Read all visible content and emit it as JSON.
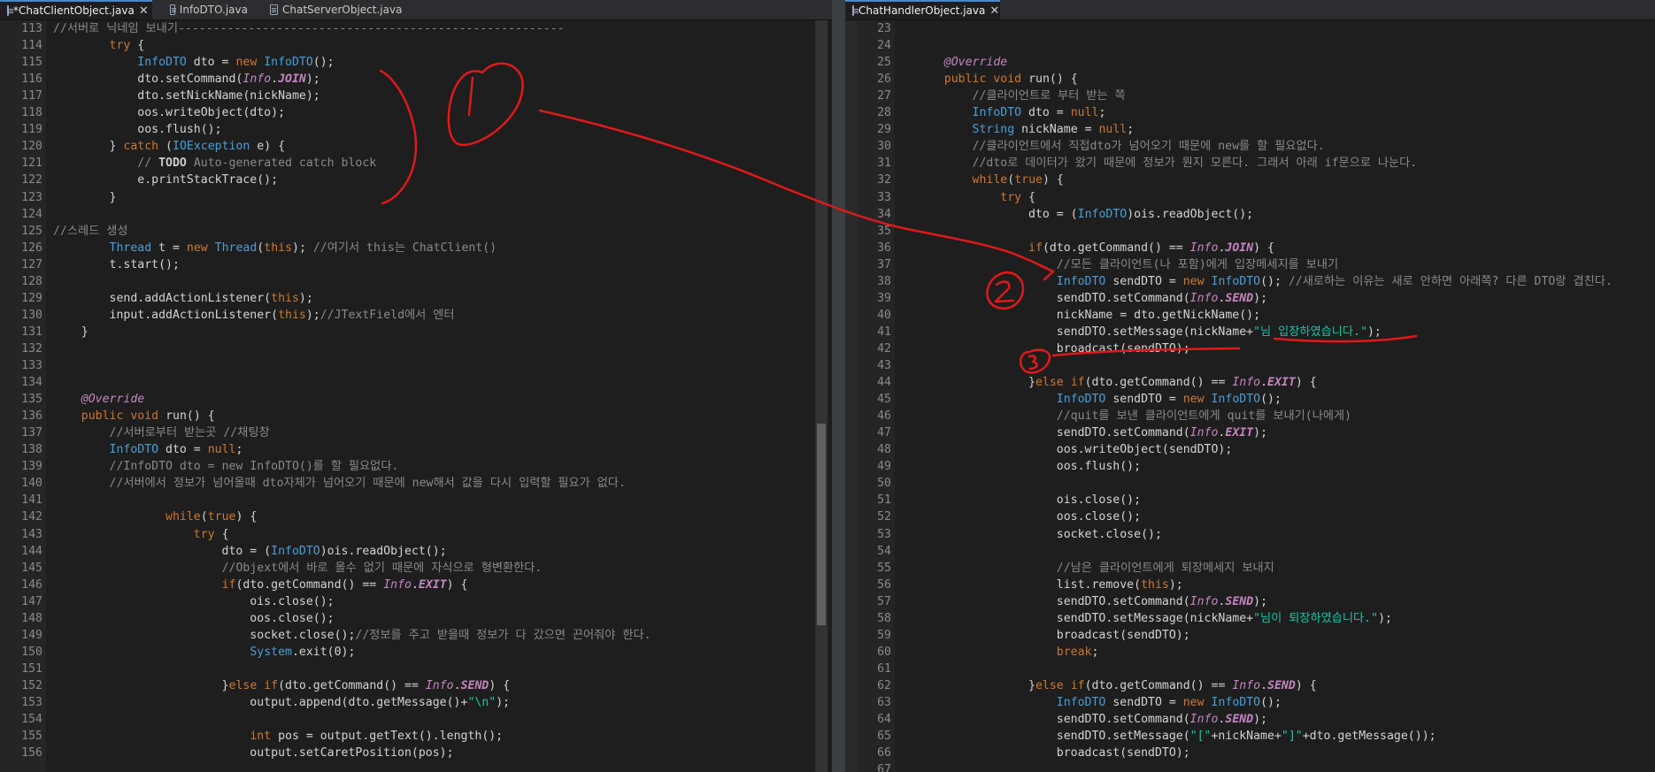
{
  "left_tabs": [
    "*ChatClientObject.java",
    "InfoDTO.java",
    "ChatServerObject.java"
  ],
  "right_tabs": [
    "ChatHandlerObject.java"
  ],
  "left_start": 113,
  "right_start": 23,
  "left_lines": [
    "//서버로 닉네임 보내기-------------------------------------------------------",
    "        try {",
    "            InfoDTO dto = new InfoDTO();",
    "            dto.setCommand(Info.JOIN);",
    "            dto.setNickName(nickName);",
    "            oos.writeObject(dto);",
    "            oos.flush();",
    "        } catch (IOException e) {",
    "            // TODO Auto-generated catch block",
    "            e.printStackTrace();",
    "        }",
    "",
    "//스레드 생성",
    "        Thread t = new Thread(this); //여기서 this는 ChatClient()",
    "        t.start();",
    "",
    "        send.addActionListener(this);",
    "        input.addActionListener(this);//JTextField에서 엔터",
    "    }",
    "",
    "",
    "",
    "    @Override",
    "    public void run() {",
    "        //서버로부터 받는곳 //채팅창",
    "        InfoDTO dto = null;",
    "        //InfoDTO dto = new InfoDTO()를 할 필요없다.",
    "        //서버에서 정보가 넘어올때 dto자체가 넘어오기 때문에 new해서 값을 다시 입력할 필요가 없다.",
    "",
    "                while(true) {",
    "                    try {",
    "                        dto = (InfoDTO)ois.readObject();",
    "                        //Objext에서 바로 올수 없기 때문에 자식으로 형변환한다.",
    "                        if(dto.getCommand() == Info.EXIT) {",
    "                            ois.close();",
    "                            oos.close();",
    "                            socket.close();//정보를 주고 받을때 정보가 다 갔으면 끈어줘야 한다.",
    "                            System.exit(0);",
    "",
    "                        }else if(dto.getCommand() == Info.SEND) {",
    "                            output.append(dto.getMessage()+\"\\n\");",
    "",
    "                            int pos = output.getText().length();",
    "                            output.setCaretPosition(pos);"
  ],
  "right_lines": [
    "",
    "",
    "    @Override",
    "    public void run() {",
    "        //클라이언트로 부터 받는 쪽",
    "        InfoDTO dto = null;",
    "        String nickName = null;",
    "        //클라이언트에서 직접dto가 넘어오기 때문에 new를 할 필요없다.",
    "        //dto로 데이터가 왔기 때문에 정보가 뭔지 모른다. 그래서 아래 if문으로 나눈다.",
    "        while(true) {",
    "            try {",
    "                dto = (InfoDTO)ois.readObject();",
    "",
    "                if(dto.getCommand() == Info.JOIN) {",
    "                    //모든 클라이언트(나 포함)에게 입장메세지를 보내기",
    "                    InfoDTO sendDTO = new InfoDTO(); //새로하는 이유는 새로 안하면 아래쪽? 다른 DTO랑 겹친다.",
    "                    sendDTO.setCommand(Info.SEND);",
    "                    nickName = dto.getNickName();",
    "                    sendDTO.setMessage(nickName+\"님 입장하였습니다.\");",
    "                    broadcast(sendDTO);",
    "",
    "                }else if(dto.getCommand() == Info.EXIT) {",
    "                    InfoDTO sendDTO = new InfoDTO();",
    "                    //quit를 보낸 클라이언트에게 quit를 보내기(나에게)",
    "                    sendDTO.setCommand(Info.EXIT);",
    "                    oos.writeObject(sendDTO);",
    "                    oos.flush();",
    "",
    "                    ois.close();",
    "                    oos.close();",
    "                    socket.close();",
    "",
    "                    //남은 클라이언트에게 퇴장메세지 보내지",
    "                    list.remove(this);",
    "                    sendDTO.setCommand(Info.SEND);",
    "                    sendDTO.setMessage(nickName+\"님이 퇴장하였습니다.\");",
    "                    broadcast(sendDTO);",
    "                    break;",
    "",
    "                }else if(dto.getCommand() == Info.SEND) {",
    "                    InfoDTO sendDTO = new InfoDTO();",
    "                    sendDTO.setCommand(Info.SEND);",
    "                    sendDTO.setMessage(\"[\"+nickName+\"]\"+dto.getMessage());",
    "                    broadcast(sendDTO);",
    ""
  ],
  "annotations": {
    "mark_1": "1",
    "mark_2": "2",
    "mark_3": "3",
    "ink_color": "#e0191b"
  },
  "colors": {
    "keyword": "#cc7832",
    "type": "#4a9fd8",
    "comment": "#8a8a8a",
    "string": "#17c6a3",
    "constant": "#c586c0"
  }
}
